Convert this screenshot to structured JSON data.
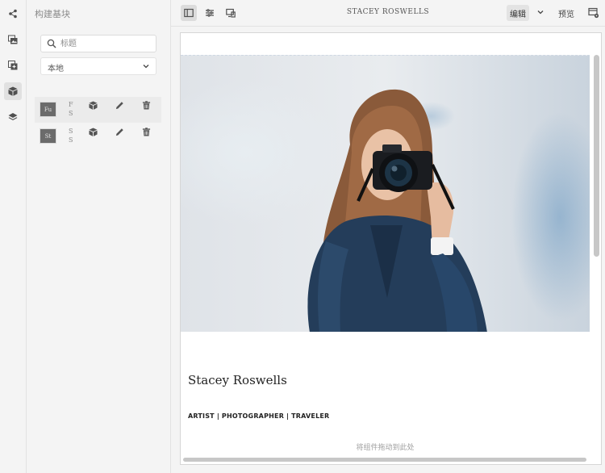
{
  "panel": {
    "title": "构建基块",
    "search_placeholder": "标题",
    "filter_value": "本地",
    "fragments": [
      {
        "thumb_label": "Fu",
        "name": "FS",
        "selected": true
      },
      {
        "thumb_label": "St",
        "name": "SS",
        "selected": false
      }
    ]
  },
  "rail": {
    "icons": [
      "share-icon",
      "assets-icon",
      "components-icon",
      "building-blocks-icon",
      "layers-icon"
    ]
  },
  "toolbar": {
    "title": "STACEY ROSWELLS",
    "mode_label": "编辑",
    "preview_label": "预览"
  },
  "page": {
    "name": "Stacey Roswells",
    "tagline": "ARTIST | PHOTOGRAPHER | TRAVELER",
    "drop_hint": "将组件拖动到此处"
  }
}
